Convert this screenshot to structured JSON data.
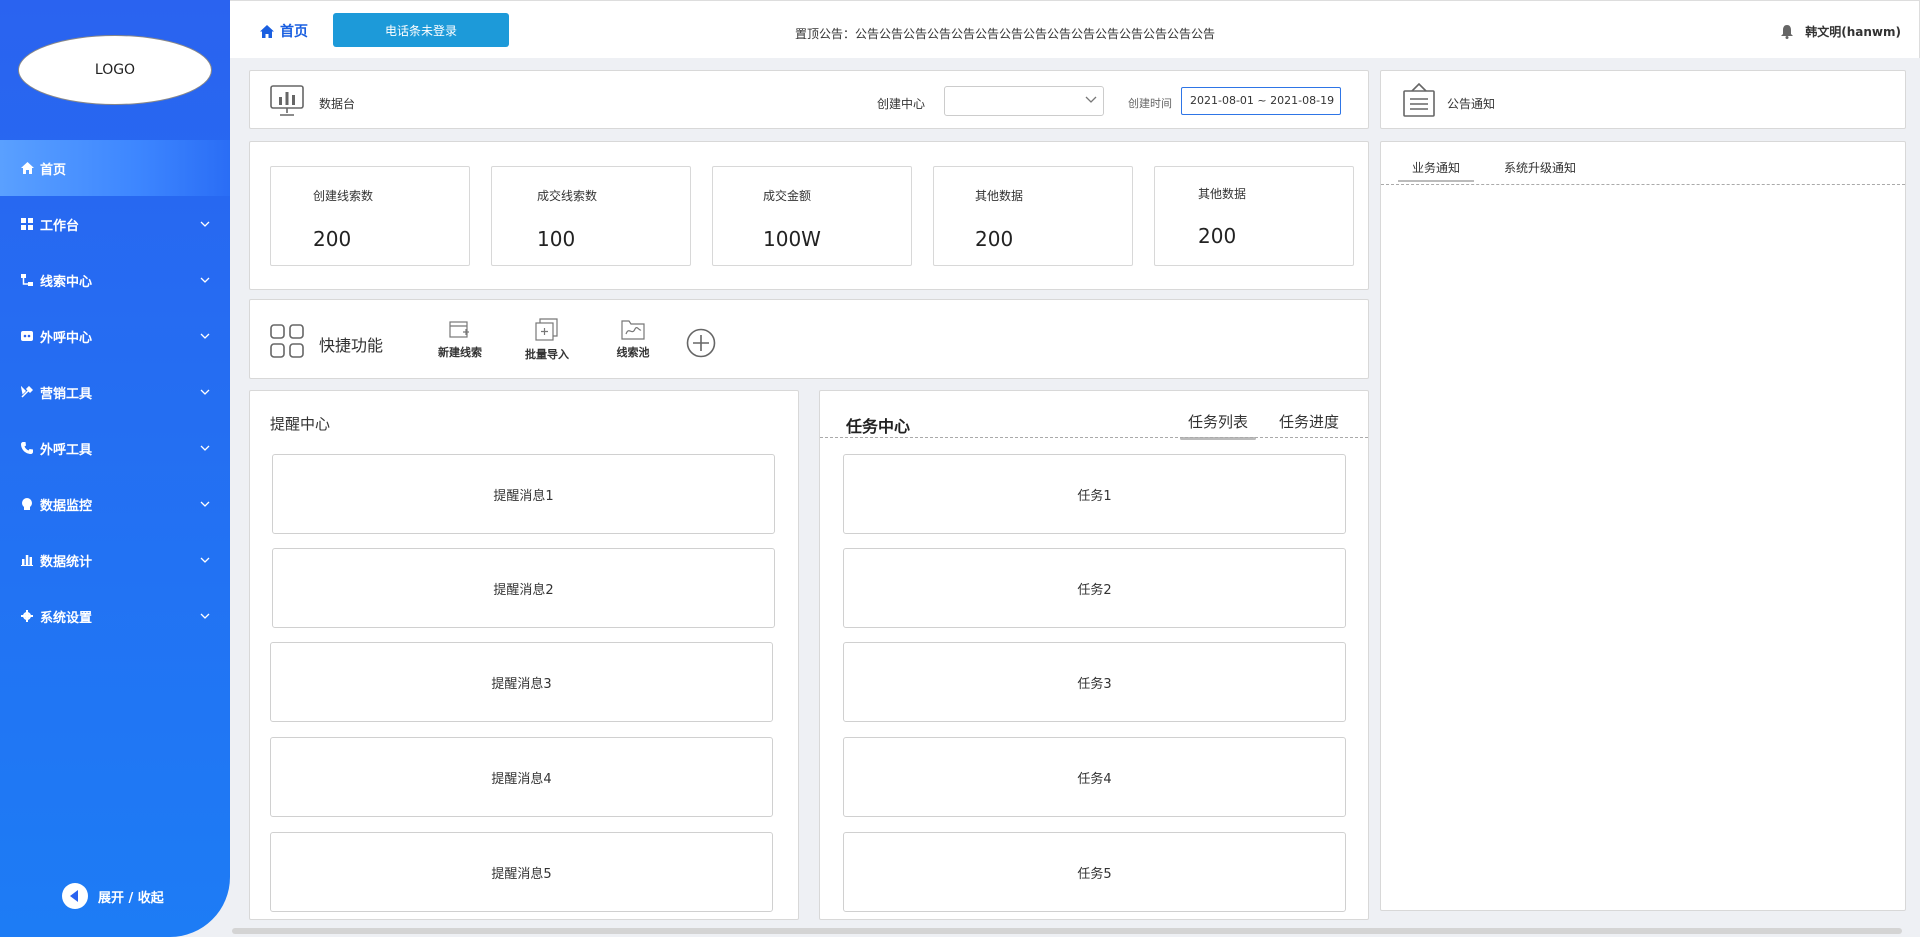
{
  "sidebar": {
    "logo": "LOGO",
    "items": [
      {
        "label": "首页",
        "icon": "home-icon"
      },
      {
        "label": "工作台",
        "icon": "grid-icon"
      },
      {
        "label": "线索中心",
        "icon": "flow-icon"
      },
      {
        "label": "外呼中心",
        "icon": "headset-icon"
      },
      {
        "label": "营销工具",
        "icon": "tools-icon"
      },
      {
        "label": "外呼工具",
        "icon": "phone-icon"
      },
      {
        "label": "数据监控",
        "icon": "monitor-icon"
      },
      {
        "label": "数据统计",
        "icon": "bar-chart-icon"
      },
      {
        "label": "系统设置",
        "icon": "gear-icon"
      }
    ],
    "collapse_label": "展开 / 收起"
  },
  "header": {
    "home_label": "首页",
    "phone_button": "电话条未登录",
    "notice": "置顶公告：公告公告公告公告公告公告公告公告公告公告公告公告公告公告公告",
    "user": "韩文明(hanwm)"
  },
  "toolbar": {
    "title": "数据台",
    "center_label": "创建中心",
    "center_value": "",
    "time_label": "创建时间",
    "date_range": "2021-08-01 ~ 2021-08-19"
  },
  "stats": [
    {
      "label": "创建线索数",
      "value": "200"
    },
    {
      "label": "成交线索数",
      "value": "100"
    },
    {
      "label": "成交金额",
      "value": "100W"
    },
    {
      "label": "其他数据",
      "value": "200"
    },
    {
      "label": "其他数据",
      "value": "200"
    }
  ],
  "quick": {
    "title": "快捷功能",
    "actions": [
      "新建线索",
      "批量导入",
      "线索池"
    ]
  },
  "reminder": {
    "title": "提醒中心",
    "messages": [
      "提醒消息1",
      "提醒消息2",
      "提醒消息3",
      "提醒消息4",
      "提醒消息5"
    ]
  },
  "tasks": {
    "title": "任务中心",
    "tabs": [
      "任务列表",
      "任务进度"
    ],
    "items": [
      "任务1",
      "任务2",
      "任务3",
      "任务4",
      "任务5"
    ]
  },
  "announce": {
    "title": "公告通知",
    "tabs": [
      "业务通知",
      "系统升级通知"
    ]
  },
  "colors": {
    "brand": "#2a63f0",
    "phone_button": "#1d9ad9",
    "link": "#1a5fe0"
  }
}
